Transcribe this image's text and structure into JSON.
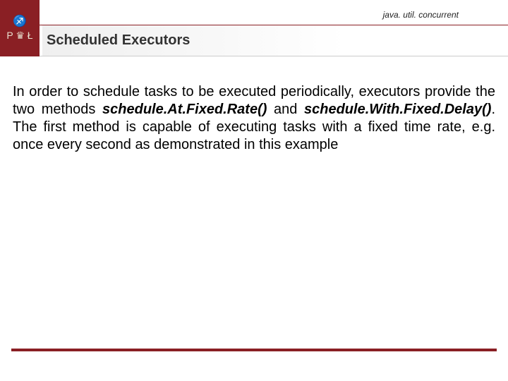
{
  "header": {
    "package": "java. util. concurrent",
    "title": "Scheduled Executors",
    "logo_top": "♐",
    "logo_bottom": "P ♛ Ł"
  },
  "body": {
    "t1": "In order to schedule tasks to be executed periodically, executors provide the two methods ",
    "m1": "schedule.At.Fixed.Rate()",
    "t2": " and ",
    "m2": "schedule.With.Fixed.Delay()",
    "t3": ". The first method is capable of executing tasks with a fixed time rate, e.g. once every second as demonstrated in this example"
  }
}
